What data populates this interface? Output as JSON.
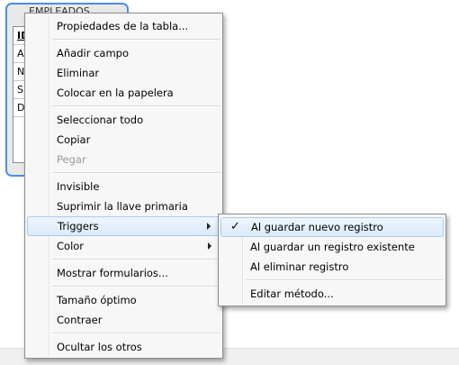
{
  "table": {
    "title": "EMPLEADOS",
    "rows": [
      "ID",
      "A",
      "N",
      "S",
      "D"
    ]
  },
  "context_menu": {
    "items": [
      {
        "label": "Propiedades de la tabla..."
      },
      {
        "label": "Añadir campo"
      },
      {
        "label": "Eliminar"
      },
      {
        "label": "Colocar en la papelera"
      },
      {
        "label": "Seleccionar todo"
      },
      {
        "label": "Copiar"
      },
      {
        "label": "Pegar",
        "disabled": true
      },
      {
        "label": "Invisible"
      },
      {
        "label": "Suprimir la llave primaria"
      },
      {
        "label": "Triggers",
        "submenu": true,
        "highlighted": true
      },
      {
        "label": "Color",
        "submenu": true
      },
      {
        "label": "Mostrar formularios..."
      },
      {
        "label": "Tamaño óptimo"
      },
      {
        "label": "Contraer"
      },
      {
        "label": "Ocultar los otros"
      }
    ]
  },
  "triggers_submenu": {
    "items": [
      {
        "label": "Al guardar nuevo registro",
        "checked": true,
        "check_glyph": "✓"
      },
      {
        "label": "Al guardar un registro existente"
      },
      {
        "label": "Al eliminar registro"
      },
      {
        "label": "Editar método..."
      }
    ]
  },
  "colors": {
    "selection_border": "#4d8fe0",
    "highlight_border": "#a8caf0",
    "menu_background": "#f7f7f7"
  }
}
